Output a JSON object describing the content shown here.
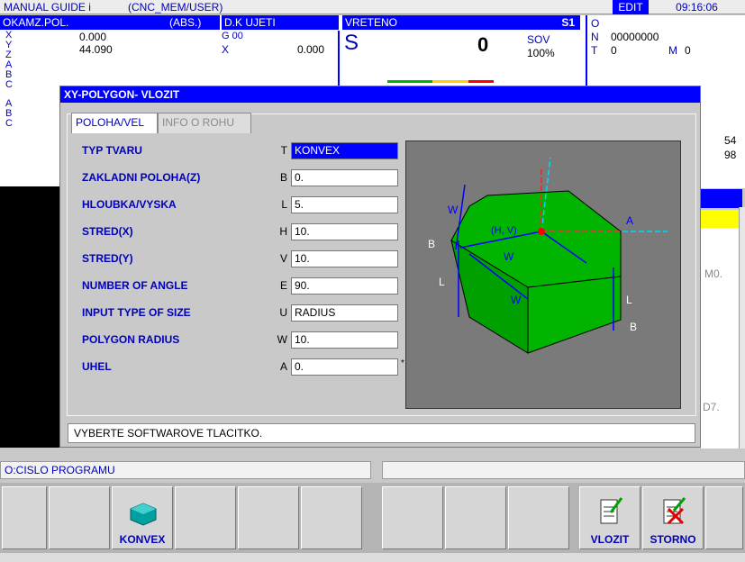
{
  "titlebar": {
    "app": "MANUAL GUIDE i",
    "path": "(CNC_MEM/USER)",
    "mode": "EDIT",
    "time": "09:16:06"
  },
  "status": {
    "position_header": "OKAMZ.POL.",
    "position_mode": "(ABS.)",
    "axes": [
      "X",
      "Y",
      "Z",
      "A",
      "B",
      "C"
    ],
    "pos_x": "0.000",
    "pos_y": "44.090",
    "dk_header": "D.K UJETI",
    "g_code": "G 00",
    "dk_axis": "X",
    "dk_x": "0.000",
    "spindle_header": "VRETENO",
    "spindle_id": "S1",
    "spindle_letter": "S",
    "spindle_value": "0",
    "sov_label": "SOV",
    "sov_value": "100%",
    "o_label": "O",
    "n_label": "N",
    "n_value": "00000000",
    "t_label": "T",
    "t_value": "0",
    "m_label": "M",
    "m_value": "0",
    "right_val1": "54",
    "right_val2": "98",
    "right_m0": "M0.",
    "right_d7": "D7."
  },
  "dialog": {
    "title": "XY-POLYGON- VLOZIT",
    "tabs": [
      {
        "label": "POLOHA/VEL",
        "active": true
      },
      {
        "label": "INFO O ROHU",
        "active": false
      }
    ],
    "rows": [
      {
        "label": "TYP TVARU",
        "letter": "T",
        "value": "KONVEX"
      },
      {
        "label": "ZAKLADNI POLOHA(Z)",
        "letter": "B",
        "value": "0."
      },
      {
        "label": "HLOUBKA/VYSKA",
        "letter": "L",
        "value": "5."
      },
      {
        "label": "STRED(X)",
        "letter": "H",
        "value": "10."
      },
      {
        "label": "STRED(Y)",
        "letter": "V",
        "value": "10."
      },
      {
        "label": "NUMBER OF ANGLE",
        "letter": "E",
        "value": "90."
      },
      {
        "label": "INPUT TYPE OF SIZE",
        "letter": "U",
        "value": "RADIUS"
      },
      {
        "label": "POLYGON RADIUS",
        "letter": "W",
        "value": "10."
      },
      {
        "label": "UHEL",
        "letter": "A",
        "value": "0."
      }
    ],
    "asterisk": "*",
    "message": "VYBERTE SOFTWAROVE TLACITKO.",
    "diagram_labels": {
      "w1": "W",
      "w2": "W",
      "w3": "W",
      "hv": "(H, V)",
      "a": "A",
      "b_left": "B",
      "b_right": "B",
      "l_left": "L",
      "l_right": "L"
    }
  },
  "bottom": {
    "program_label": "O:CISLO PROGRAMU"
  },
  "softkeys": [
    {
      "label": ""
    },
    {
      "label": ""
    },
    {
      "label": "KONVEX",
      "icon": "convex-shape-icon"
    },
    {
      "label": ""
    },
    {
      "label": ""
    },
    {
      "label": ""
    },
    {
      "label": ""
    },
    {
      "label": ""
    },
    {
      "label": ""
    },
    {
      "label": "VLOZIT",
      "icon": "document-insert-icon"
    },
    {
      "label": "STORNO",
      "icon": "document-cancel-icon"
    },
    {
      "label": ""
    }
  ],
  "colors": {
    "accent": "#0000ff",
    "label_blue": "#0000b8",
    "shape_green": "#00b400",
    "highlight_yellow": "#ffff00"
  }
}
